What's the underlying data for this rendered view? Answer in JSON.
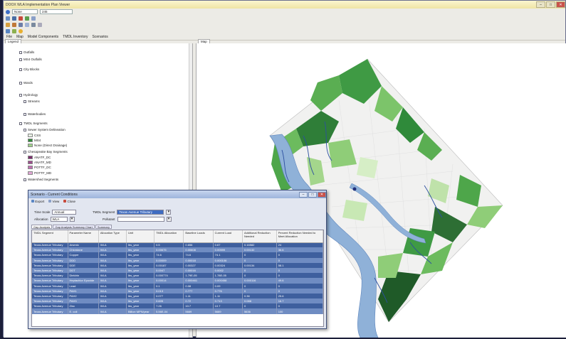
{
  "window": {
    "title": "DOOX WLA Implementation Plan Viewer",
    "minimize": "–",
    "maximize": "□",
    "close": "✕"
  },
  "toolbar": {
    "scale_select": "None",
    "zoom_select": "245"
  },
  "menu": {
    "items": [
      "File",
      "Map",
      "Model Components",
      "TMDL Inventory",
      "Scenarios"
    ]
  },
  "legend": {
    "tab": "Legend",
    "items": [
      {
        "label": "Outfalls",
        "indent": 1
      },
      {
        "label": "MS4 Outfalls",
        "indent": 1
      },
      {
        "label": "City Blocks",
        "indent": 1
      },
      {
        "label": "Wards",
        "indent": 1
      },
      {
        "label": "Hydrology",
        "indent": 1
      },
      {
        "label": "Streams",
        "indent": 2
      },
      {
        "label": "Waterbodies",
        "indent": 2
      },
      {
        "label": "TMDL Segments",
        "indent": 1
      },
      {
        "label": "Sewer System Delineation",
        "indent": 2
      },
      {
        "label": "CSS",
        "indent": 3,
        "swatch": "#e8f0e4"
      },
      {
        "label": "MS4",
        "indent": 3,
        "swatch": "#2f8a3a"
      },
      {
        "label": "None (Direct Drainage)",
        "indent": 3,
        "swatch": "#9fd08a"
      },
      {
        "label": "Chesapeake Bay Segments",
        "indent": 2
      },
      {
        "label": "ANATF_DC",
        "indent": 3,
        "swatch": "#7d2f6e"
      },
      {
        "label": "ANATF_MD",
        "indent": 3,
        "swatch": "#9c4d8c"
      },
      {
        "label": "POTTF_DC",
        "indent": 3,
        "swatch": "#c16fb2"
      },
      {
        "label": "POTTF_MD",
        "indent": 3,
        "swatch": "#e0a5d4"
      },
      {
        "label": "Watershed Segments",
        "indent": 2
      },
      {
        "label": "Lower Anacostia",
        "indent": 3,
        "swatch": "#5a9e4d"
      }
    ]
  },
  "map": {
    "tab": "Map"
  },
  "dialog": {
    "title": "Scenario - Current Conditions",
    "toolbar": [
      "Export",
      "View",
      "Close"
    ],
    "time_scale_label": "Time Scale",
    "time_scale_value": "Annual",
    "allocation_label": "Allocation",
    "allocation_value": "WLA",
    "tmdl_segment_label": "TMDL Segment",
    "tmdl_segment_value": "Texas Avenue Tributary",
    "pollutant_label": "Pollutant",
    "pollutant_value": "",
    "tabs": [
      "Gap Analysis",
      "Gap Analysis Summary Chart",
      "Summary"
    ],
    "columns": [
      "TMDL Segment",
      "Parameter Name",
      "Allocation Type",
      "Unit",
      "TMDL Allocation",
      "Baseline Loads",
      "Current Load",
      "Additional Reduction Needed",
      "Percent Reduction Needed to Meet Allocation"
    ],
    "rows": [
      [
        "Texas Avenue Tributary",
        "Arsenic",
        "WLA",
        "lbs_year",
        "0.5",
        "0.656",
        "0.67",
        "0.16582",
        "24"
      ],
      [
        "Texas Avenue Tributary",
        "Chlordane",
        "WLA",
        "lbs_year",
        "0.00675",
        "0.00608",
        "0.00599",
        "0.00132",
        "36.6"
      ],
      [
        "Texas Avenue Tributary",
        "Copper",
        "WLA",
        "lbs_year",
        "74.6",
        "74.6",
        "74.1",
        "0",
        "0"
      ],
      [
        "Texas Avenue Tributary",
        "DDD",
        "WLA",
        "lbs_year",
        "0.00009",
        "0.00018",
        "0.000106",
        "0",
        "0"
      ],
      [
        "Texas Avenue Tributary",
        "DDE",
        "WLA",
        "lbs_year",
        "0.00187",
        "0.00327",
        "0.00324",
        "0.00134",
        "58.1"
      ],
      [
        "Texas Avenue Tributary",
        "DDT",
        "WLA",
        "lbs_year",
        "0.0047",
        "0.00016",
        "0.0002",
        "0",
        "0"
      ],
      [
        "Texas Avenue Tributary",
        "Dieldrin",
        "WLA",
        "lbs_year",
        "0.000774",
        "1.79E-05",
        "1.78E-05",
        "0",
        "0"
      ],
      [
        "Texas Avenue Tributary",
        "Heptachlor Epoxide",
        "WLA",
        "lbs_year",
        "0.00014",
        "0.000461",
        "0.000458",
        "0.000116",
        "49.6"
      ],
      [
        "Texas Avenue Tributary",
        "Lead",
        "WLA",
        "lbs_year",
        "0.1",
        "0.08",
        "0.09",
        "0",
        "0"
      ],
      [
        "Texas Avenue Tributary",
        "PAH1",
        "WLA",
        "lbs_year",
        "0.013",
        "0.777",
        "0.776",
        "0",
        "0"
      ],
      [
        "Texas Avenue Tributary",
        "PAH2",
        "WLA",
        "lbs_year",
        "0.077",
        "1.11",
        "1.11",
        "0.36",
        "25.6"
      ],
      [
        "Texas Avenue Tributary",
        "PAH3",
        "WLA",
        "lbs_year",
        "0.605",
        "0.72",
        "0.713",
        "0.088",
        "16.7"
      ],
      [
        "Texas Avenue Tributary",
        "Zinc",
        "WLA",
        "lbs_year",
        "7.26",
        "10.7",
        "10.7",
        "0",
        "0"
      ],
      [
        "Texas Avenue Tributary",
        "E. coli",
        "WLA",
        "Billion MPN/year",
        "5.56E-04",
        "5669",
        "5689",
        "5636",
        "100"
      ]
    ]
  }
}
